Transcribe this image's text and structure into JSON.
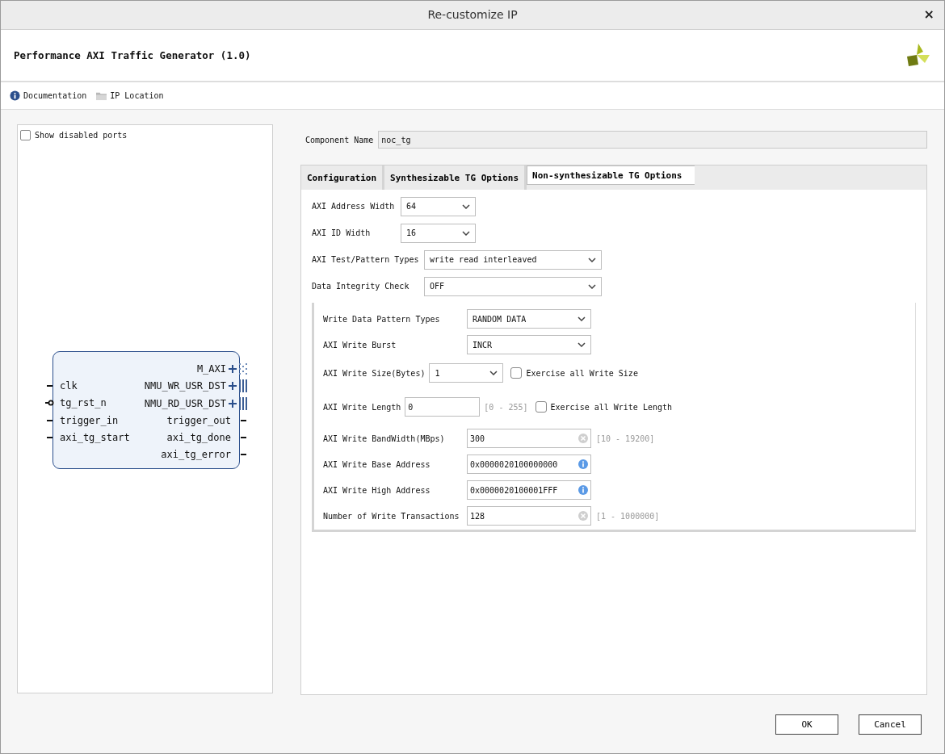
{
  "window": {
    "title": "Re-customize IP",
    "close": "×"
  },
  "header": {
    "title": "Performance AXI Traffic Generator (1.0)"
  },
  "toolbar": [
    {
      "label": "Documentation",
      "kind": "info"
    },
    {
      "label": "IP Location",
      "kind": "folder"
    }
  ],
  "left_panel": {
    "show_disabled_ports": {
      "label": "Show disabled ports",
      "checked": false
    },
    "block": {
      "left_ports": [
        {
          "name": "clk",
          "kind": "plain"
        },
        {
          "name": "tg_rst_n",
          "kind": "inverted"
        },
        {
          "name": "trigger_in",
          "kind": "plain"
        },
        {
          "name": "axi_tg_start",
          "kind": "plain"
        }
      ],
      "right_ports": [
        {
          "name": "M_AXI",
          "kind": "bus-disabled"
        },
        {
          "name": "NMU_WR_USR_DST",
          "kind": "bus"
        },
        {
          "name": "NMU_RD_USR_DST",
          "kind": "bus"
        },
        {
          "name": "trigger_out",
          "kind": "plain"
        },
        {
          "name": "axi_tg_done",
          "kind": "plain"
        },
        {
          "name": "axi_tg_error",
          "kind": "plain"
        }
      ]
    }
  },
  "component_name": {
    "label": "Component Name",
    "value": "noc_tg"
  },
  "tabs": [
    {
      "label": "Configuration",
      "selected": false
    },
    {
      "label": "Synthesizable TG Options",
      "selected": false
    },
    {
      "label": "Non-synthesizable TG Options",
      "selected": true
    }
  ],
  "options": [
    {
      "label": "AXI Address Width",
      "kind": "select",
      "value": "64"
    },
    {
      "label": "AXI ID Width",
      "kind": "select",
      "value": "16"
    },
    {
      "label": "AXI Test/Pattern Types",
      "kind": "select",
      "value": "write read interleaved"
    },
    {
      "label": "Data Integrity Check",
      "kind": "select",
      "value": "OFF"
    }
  ],
  "write_options": [
    {
      "label": "Write Data Pattern Types",
      "kind": "select",
      "value": "RANDOM DATA"
    },
    {
      "label": "AXI Write Burst",
      "kind": "select",
      "value": "INCR"
    },
    {
      "label": "AXI Write Size(Bytes)",
      "kind": "select",
      "value": "1",
      "checkbox": {
        "label": "Exercise all Write Size",
        "checked": false
      }
    },
    {
      "label": "AXI Write Length",
      "kind": "text",
      "value": "0",
      "range": "[0 - 255]",
      "checkbox": {
        "label": "Exercise all Write Length",
        "checked": false
      }
    },
    {
      "label": "AXI Write BandWidth(MBps)",
      "kind": "text",
      "value": "300",
      "clear_button": true,
      "range": "[10 - 19200]"
    },
    {
      "label": "AXI Write Base Address",
      "kind": "text",
      "value": "0x0000020100000000",
      "info_icon": true
    },
    {
      "label": "AXI Write High Address",
      "kind": "text",
      "value": "0x0000020100001FFF",
      "info_icon": true
    },
    {
      "label": "Number of Write Transactions",
      "kind": "text",
      "value": "128",
      "clear_button": true,
      "range": "[1 - 1000000]"
    }
  ],
  "buttons": [
    "OK",
    "Cancel"
  ]
}
